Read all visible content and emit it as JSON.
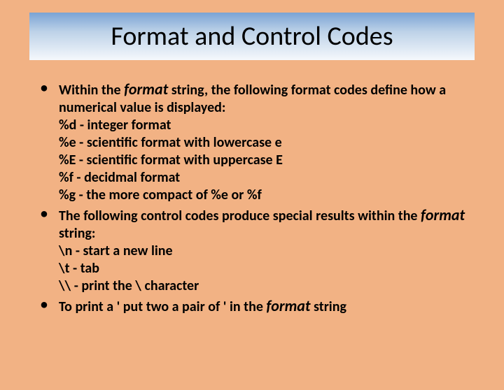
{
  "title": "Format and Control Codes",
  "bullets": {
    "b1": {
      "pre": "Within the ",
      "em": "format",
      "post": " string, the following format codes define how a numerical value is displayed:",
      "l1": "%d - integer format",
      "l2": "%e - scientific format with lowercase e",
      "l3": "%E - scientific format with uppercase E",
      "l4": "%f - decidmal format",
      "l5": "%g - the more compact of %e or %f"
    },
    "b2": {
      "pre": "The following control codes produce special results within the ",
      "em": "format",
      "post": " string:",
      "l1": "\\n - start a new line",
      "l2": "\\t - tab",
      "l3": "\\\\ - print the \\ character"
    },
    "b3": {
      "pre": "To print a '  put two a pair of ' in the ",
      "em": "format",
      "post": " string"
    }
  }
}
